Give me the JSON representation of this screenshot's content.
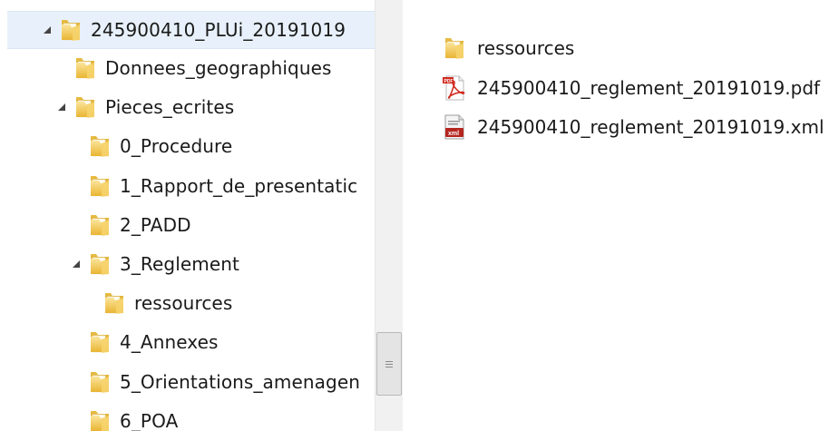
{
  "tree": {
    "nodes": [
      {
        "label": "245900410_PLUi_20191019",
        "expanded": true,
        "selected": true
      },
      {
        "label": "Donnees_geographiques",
        "expanded": false
      },
      {
        "label": "Pieces_ecrites",
        "expanded": true
      },
      {
        "label": "0_Procedure",
        "expanded": false
      },
      {
        "label": "1_Rapport_de_presentatic",
        "expanded": false
      },
      {
        "label": "2_PADD",
        "expanded": false
      },
      {
        "label": "3_Reglement",
        "expanded": true
      },
      {
        "label": "ressources",
        "expanded": false
      },
      {
        "label": "4_Annexes",
        "expanded": false
      },
      {
        "label": "5_Orientations_amenagen",
        "expanded": false
      },
      {
        "label": "6_POA",
        "expanded": false
      }
    ]
  },
  "content": {
    "items": [
      {
        "label": "ressources",
        "icon": "folder-icon"
      },
      {
        "label": "245900410_reglement_20191019.pdf",
        "icon": "pdf-file-icon"
      },
      {
        "label": "245900410_reglement_20191019.xml",
        "icon": "xml-file-icon"
      }
    ]
  },
  "colors": {
    "selection": "#e8f1fb",
    "folder": "#f5c84c",
    "pdf_red": "#d12a1f",
    "xml_red": "#b5261f"
  }
}
